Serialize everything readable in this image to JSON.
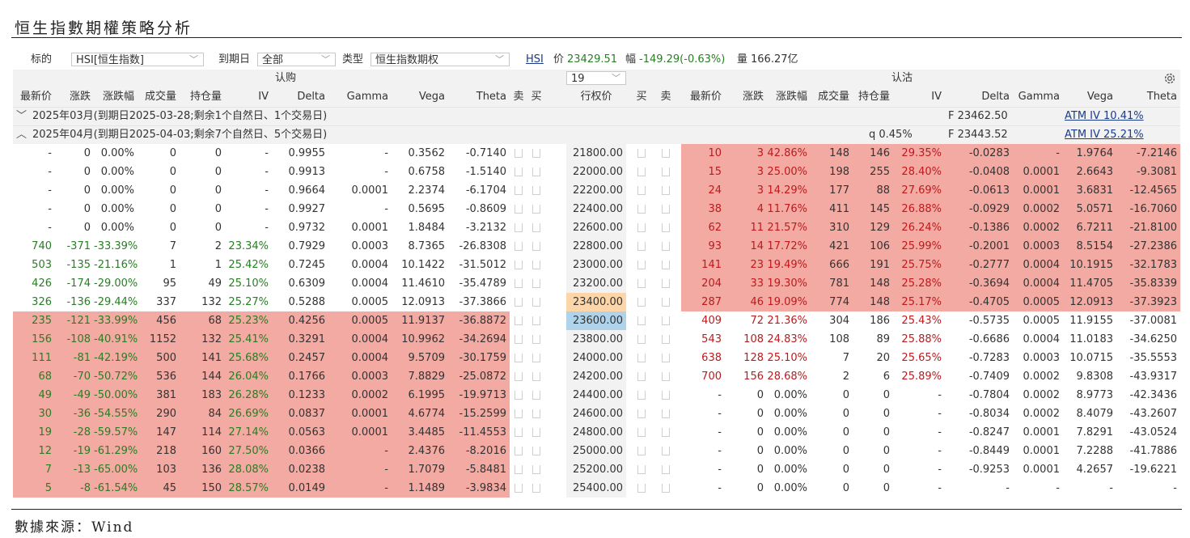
{
  "page": {
    "title": "恒生指數期權策略分析",
    "source": "數據來源：Wind"
  },
  "filters": {
    "underlying_label": "标的",
    "underlying_value": "HSI[恒生指数]",
    "expiry_label": "到期日",
    "expiry_value": "全部",
    "type_label": "类型",
    "type_value": "恒生指数期权"
  },
  "ticker": {
    "code": "HSI",
    "price_label": "价",
    "price": "23429.51",
    "change_label": "幅",
    "change": "-149.29(-0.63%)",
    "volume_label": "量",
    "volume": "166.27亿"
  },
  "table": {
    "call_label": "认购",
    "put_label": "认沽",
    "strikes_select": "19",
    "call_headers": [
      "最新价",
      "涨跌",
      "涨跌幅",
      "成交量",
      "持仓量",
      "IV",
      "Delta",
      "Gamma",
      "Vega",
      "Theta"
    ],
    "center_headers": [
      "卖",
      "买",
      "行权价",
      "买",
      "卖"
    ],
    "put_headers": [
      "最新价",
      "涨跌",
      "涨跌幅",
      "成交量",
      "持仓量",
      "IV",
      "Delta",
      "Gamma",
      "Vega",
      "Theta"
    ],
    "groups": [
      {
        "label": "2025年03月(到期日2025-03-28;剩余1个自然日、1个交易日)",
        "expanded": false,
        "q": "",
        "future": "F 23462.50",
        "atm_iv": "ATM IV 10.41%"
      },
      {
        "label": "2025年04月(到期日2025-04-03;剩余7个自然日、5个交易日)",
        "expanded": true,
        "q": "q 0.45%",
        "future": "F 23443.52",
        "atm_iv": "ATM IV 25.21%"
      }
    ],
    "rows": [
      {
        "strike": "21800.00",
        "strike_hl": "",
        "call": [
          "-",
          "0",
          "0.00%",
          "0",
          "0",
          "-",
          "0.9955",
          "-",
          "0.3562",
          "-0.7140"
        ],
        "call_itm": false,
        "call_dir": "",
        "put": [
          "10",
          "3",
          "42.86%",
          "148",
          "146",
          "29.35%",
          "-0.0283",
          "-",
          "1.9764",
          "-7.2146"
        ],
        "put_itm": true,
        "put_dir": "pos"
      },
      {
        "strike": "22000.00",
        "strike_hl": "",
        "call": [
          "-",
          "0",
          "0.00%",
          "0",
          "0",
          "-",
          "0.9913",
          "-",
          "0.6758",
          "-1.5140"
        ],
        "call_itm": false,
        "call_dir": "",
        "put": [
          "15",
          "3",
          "25.00%",
          "198",
          "255",
          "28.40%",
          "-0.0408",
          "0.0001",
          "2.6643",
          "-9.3081"
        ],
        "put_itm": true,
        "put_dir": "pos"
      },
      {
        "strike": "22200.00",
        "strike_hl": "",
        "call": [
          "-",
          "0",
          "0.00%",
          "0",
          "0",
          "-",
          "0.9664",
          "0.0001",
          "2.2374",
          "-6.1704"
        ],
        "call_itm": false,
        "call_dir": "",
        "put": [
          "24",
          "3",
          "14.29%",
          "177",
          "88",
          "27.69%",
          "-0.0613",
          "0.0001",
          "3.6831",
          "-12.4565"
        ],
        "put_itm": true,
        "put_dir": "pos"
      },
      {
        "strike": "22400.00",
        "strike_hl": "",
        "call": [
          "-",
          "0",
          "0.00%",
          "0",
          "0",
          "-",
          "0.9927",
          "-",
          "0.5695",
          "-0.8609"
        ],
        "call_itm": false,
        "call_dir": "",
        "put": [
          "38",
          "4",
          "11.76%",
          "411",
          "145",
          "26.88%",
          "-0.0929",
          "0.0002",
          "5.0571",
          "-16.7060"
        ],
        "put_itm": true,
        "put_dir": "pos"
      },
      {
        "strike": "22600.00",
        "strike_hl": "",
        "call": [
          "-",
          "0",
          "0.00%",
          "0",
          "0",
          "-",
          "0.9732",
          "0.0001",
          "1.8484",
          "-3.2132"
        ],
        "call_itm": false,
        "call_dir": "",
        "put": [
          "62",
          "11",
          "21.57%",
          "310",
          "129",
          "26.24%",
          "-0.1386",
          "0.0002",
          "6.7211",
          "-21.8100"
        ],
        "put_itm": true,
        "put_dir": "pos"
      },
      {
        "strike": "22800.00",
        "strike_hl": "",
        "call": [
          "740",
          "-371",
          "-33.39%",
          "7",
          "2",
          "23.34%",
          "0.7929",
          "0.0003",
          "8.7365",
          "-26.8308"
        ],
        "call_itm": false,
        "call_dir": "neg",
        "put": [
          "93",
          "14",
          "17.72%",
          "421",
          "106",
          "25.99%",
          "-0.2001",
          "0.0003",
          "8.5154",
          "-27.2386"
        ],
        "put_itm": true,
        "put_dir": "pos"
      },
      {
        "strike": "23000.00",
        "strike_hl": "",
        "call": [
          "503",
          "-135",
          "-21.16%",
          "1",
          "1",
          "25.42%",
          "0.7245",
          "0.0004",
          "10.1422",
          "-31.5012"
        ],
        "call_itm": false,
        "call_dir": "neg",
        "put": [
          "141",
          "23",
          "19.49%",
          "666",
          "191",
          "25.75%",
          "-0.2777",
          "0.0004",
          "10.1915",
          "-32.1783"
        ],
        "put_itm": true,
        "put_dir": "pos"
      },
      {
        "strike": "23200.00",
        "strike_hl": "",
        "call": [
          "426",
          "-174",
          "-29.00%",
          "95",
          "49",
          "25.10%",
          "0.6309",
          "0.0004",
          "11.4610",
          "-35.4789"
        ],
        "call_itm": false,
        "call_dir": "neg",
        "put": [
          "204",
          "33",
          "19.30%",
          "781",
          "148",
          "25.28%",
          "-0.3694",
          "0.0004",
          "11.4705",
          "-35.8339"
        ],
        "put_itm": true,
        "put_dir": "pos"
      },
      {
        "strike": "23400.00",
        "strike_hl": "orange",
        "call": [
          "326",
          "-136",
          "-29.44%",
          "337",
          "132",
          "25.27%",
          "0.5288",
          "0.0005",
          "12.0913",
          "-37.3866"
        ],
        "call_itm": false,
        "call_dir": "neg",
        "put": [
          "287",
          "46",
          "19.09%",
          "774",
          "148",
          "25.17%",
          "-0.4705",
          "0.0005",
          "12.0913",
          "-37.3923"
        ],
        "put_itm": true,
        "put_dir": "pos"
      },
      {
        "strike": "23600.00",
        "strike_hl": "blue",
        "call": [
          "235",
          "-121",
          "-33.99%",
          "456",
          "68",
          "25.23%",
          "0.4256",
          "0.0005",
          "11.9137",
          "-36.8872"
        ],
        "call_itm": true,
        "call_dir": "neg",
        "put": [
          "409",
          "72",
          "21.36%",
          "304",
          "186",
          "25.43%",
          "-0.5735",
          "0.0005",
          "11.9155",
          "-37.0081"
        ],
        "put_itm": false,
        "put_dir": "pos"
      },
      {
        "strike": "23800.00",
        "strike_hl": "",
        "call": [
          "156",
          "-108",
          "-40.91%",
          "1152",
          "132",
          "25.41%",
          "0.3291",
          "0.0004",
          "10.9962",
          "-34.2694"
        ],
        "call_itm": true,
        "call_dir": "neg",
        "put": [
          "543",
          "108",
          "24.83%",
          "108",
          "89",
          "25.88%",
          "-0.6686",
          "0.0004",
          "11.0183",
          "-34.6250"
        ],
        "put_itm": false,
        "put_dir": "pos"
      },
      {
        "strike": "24000.00",
        "strike_hl": "",
        "call": [
          "111",
          "-81",
          "-42.19%",
          "500",
          "141",
          "25.68%",
          "0.2457",
          "0.0004",
          "9.5709",
          "-30.1759"
        ],
        "call_itm": true,
        "call_dir": "neg",
        "put": [
          "638",
          "128",
          "25.10%",
          "7",
          "20",
          "25.65%",
          "-0.7283",
          "0.0003",
          "10.0715",
          "-35.5553"
        ],
        "put_itm": false,
        "put_dir": "pos"
      },
      {
        "strike": "24200.00",
        "strike_hl": "",
        "call": [
          "68",
          "-70",
          "-50.72%",
          "536",
          "144",
          "26.04%",
          "0.1766",
          "0.0003",
          "7.8829",
          "-25.0872"
        ],
        "call_itm": true,
        "call_dir": "neg",
        "put": [
          "700",
          "156",
          "28.68%",
          "2",
          "6",
          "25.89%",
          "-0.7409",
          "0.0002",
          "9.8308",
          "-43.9317"
        ],
        "put_itm": false,
        "put_dir": "pos"
      },
      {
        "strike": "24400.00",
        "strike_hl": "",
        "call": [
          "49",
          "-49",
          "-50.00%",
          "381",
          "183",
          "26.28%",
          "0.1233",
          "0.0002",
          "6.1995",
          "-19.9713"
        ],
        "call_itm": true,
        "call_dir": "neg",
        "put": [
          "-",
          "0",
          "0.00%",
          "0",
          "0",
          "-",
          "-0.7804",
          "0.0002",
          "8.9773",
          "-42.3436"
        ],
        "put_itm": false,
        "put_dir": ""
      },
      {
        "strike": "24600.00",
        "strike_hl": "",
        "call": [
          "30",
          "-36",
          "-54.55%",
          "290",
          "84",
          "26.69%",
          "0.0837",
          "0.0001",
          "4.6774",
          "-15.2599"
        ],
        "call_itm": true,
        "call_dir": "neg",
        "put": [
          "-",
          "0",
          "0.00%",
          "0",
          "0",
          "-",
          "-0.8034",
          "0.0002",
          "8.4079",
          "-43.2607"
        ],
        "put_itm": false,
        "put_dir": ""
      },
      {
        "strike": "24800.00",
        "strike_hl": "",
        "call": [
          "19",
          "-28",
          "-59.57%",
          "147",
          "114",
          "27.14%",
          "0.0563",
          "0.0001",
          "3.4485",
          "-11.4553"
        ],
        "call_itm": true,
        "call_dir": "neg",
        "put": [
          "-",
          "0",
          "0.00%",
          "0",
          "0",
          "-",
          "-0.8247",
          "0.0001",
          "7.8291",
          "-43.0524"
        ],
        "put_itm": false,
        "put_dir": ""
      },
      {
        "strike": "25000.00",
        "strike_hl": "",
        "call": [
          "12",
          "-19",
          "-61.29%",
          "218",
          "160",
          "27.50%",
          "0.0366",
          "-",
          "2.4376",
          "-8.2016"
        ],
        "call_itm": true,
        "call_dir": "neg",
        "put": [
          "-",
          "0",
          "0.00%",
          "0",
          "0",
          "-",
          "-0.8449",
          "0.0001",
          "7.2288",
          "-41.7886"
        ],
        "put_itm": false,
        "put_dir": ""
      },
      {
        "strike": "25200.00",
        "strike_hl": "",
        "call": [
          "7",
          "-13",
          "-65.00%",
          "103",
          "136",
          "28.08%",
          "0.0238",
          "-",
          "1.7079",
          "-5.8481"
        ],
        "call_itm": true,
        "call_dir": "neg",
        "put": [
          "-",
          "0",
          "0.00%",
          "0",
          "0",
          "-",
          "-0.9253",
          "0.0001",
          "4.2657",
          "-19.6221"
        ],
        "put_itm": false,
        "put_dir": ""
      },
      {
        "strike": "25400.00",
        "strike_hl": "",
        "call": [
          "5",
          "-8",
          "-61.54%",
          "45",
          "150",
          "28.57%",
          "0.0149",
          "-",
          "1.1489",
          "-3.9834"
        ],
        "call_itm": true,
        "call_dir": "neg",
        "put": [
          "-",
          "0",
          "0.00%",
          "0",
          "0",
          "-",
          "-",
          "-",
          "-",
          "-"
        ],
        "put_itm": false,
        "put_dir": ""
      }
    ]
  },
  "colors": {
    "itm_fill": "#f2aaa3",
    "up": "#c0191c",
    "down": "#267f22",
    "atm_strike": "#fcd6a8",
    "selected_strike": "#aed3ea"
  }
}
